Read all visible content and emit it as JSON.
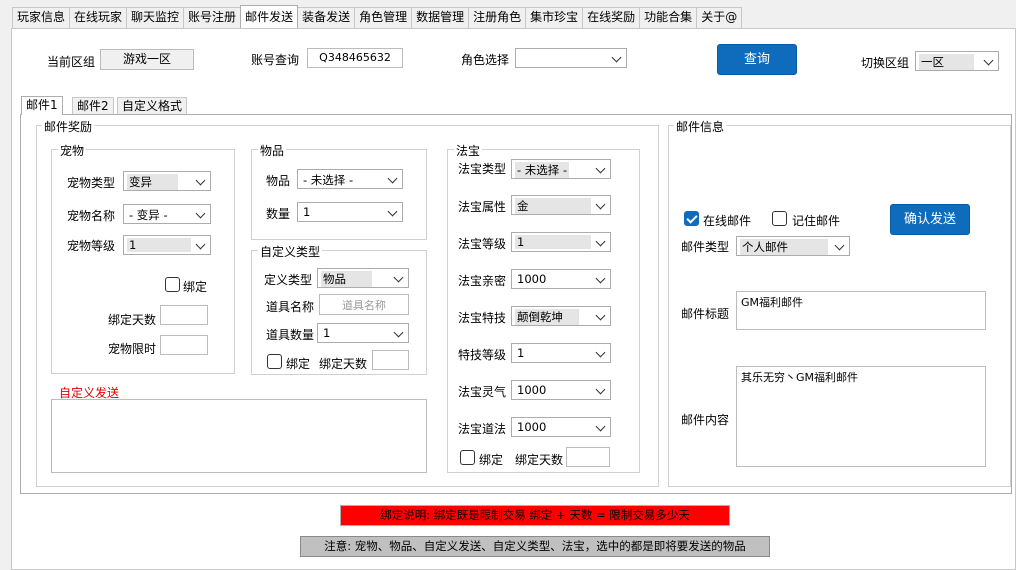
{
  "tabs": [
    "玩家信息",
    "在线玩家",
    "聊天监控",
    "账号注册",
    "邮件发送",
    "装备发送",
    "角色管理",
    "数据管理",
    "注册角色",
    "集市珍宝",
    "在线奖励",
    "功能合集",
    "关于@"
  ],
  "header": {
    "current_zone_label": "当前区组",
    "current_zone_value": "游戏一区",
    "account_query_label": "账号查询",
    "account_query_value": "Q348465632",
    "role_select_label": "角色选择",
    "role_select_value": "",
    "query_button": "查询",
    "switch_zone_label": "切换区组",
    "switch_zone_value": "一区"
  },
  "subtabs": [
    "邮件1",
    "邮件2",
    "自定义格式"
  ],
  "reward": {
    "title": "邮件奖励",
    "pet": {
      "title": "宠物",
      "type_label": "宠物类型",
      "type_value": "变异",
      "name_label": "宠物名称",
      "name_value": "- 变异 -",
      "level_label": "宠物等级",
      "level_value": "1",
      "bind_label": "绑定",
      "bind_days_label": "绑定天数",
      "bind_days_value": "",
      "limit_label": "宠物限时",
      "limit_value": ""
    },
    "item": {
      "title": "物品",
      "item_label": "物品",
      "item_value": "- 未选择 -",
      "qty_label": "数量",
      "qty_value": "1"
    },
    "custom_type": {
      "title": "自定义类型",
      "def_type_label": "定义类型",
      "def_type_value": "物品",
      "prop_name_label": "道具名称",
      "prop_name_placeholder": "道具名称",
      "prop_qty_label": "道具数量",
      "prop_qty_value": "1",
      "bind_label": "绑定",
      "bind_days_label": "绑定天数",
      "bind_days_value": ""
    },
    "custom_send": {
      "title": "自定义发送",
      "value": "",
      "title_color": "#e00000"
    },
    "fabao": {
      "title": "法宝",
      "type_label": "法宝类型",
      "type_value": "- 未选择 -",
      "attr_label": "法宝属性",
      "attr_value": "金",
      "level_label": "法宝等级",
      "level_value": "1",
      "intimacy_label": "法宝亲密",
      "intimacy_value": "1000",
      "skill_label": "法宝特技",
      "skill_value": "颠倒乾坤",
      "skill_level_label": "特技等级",
      "skill_level_value": "1",
      "spirit_label": "法宝灵气",
      "spirit_value": "1000",
      "dao_label": "法宝道法",
      "dao_value": "1000",
      "bind_label": "绑定",
      "bind_days_label": "绑定天数",
      "bind_days_value": ""
    }
  },
  "mail_info": {
    "title": "邮件信息",
    "online_mail_label": "在线邮件",
    "online_mail_checked": true,
    "remember_mail_label": "记住邮件",
    "remember_mail_checked": false,
    "confirm_button": "确认发送",
    "type_label": "邮件类型",
    "type_value": "个人邮件",
    "subject_label": "邮件标题",
    "subject_value": "GM福利邮件",
    "content_label": "邮件内容",
    "content_value": "其乐无穷丶GM福利邮件"
  },
  "notes": {
    "bind_note": "绑定说明: 绑定既是限制交易 绑定 + 天数 = 限制交易多少天",
    "bind_note_bg": "#ff0000",
    "notice": "注意: 宠物、物品、自定义发送、自定义类型、法宝，选中的都是即将要发送的物品",
    "notice_bg": "#c0c0c0"
  },
  "colors": {
    "accent": "#0f6cbd"
  }
}
